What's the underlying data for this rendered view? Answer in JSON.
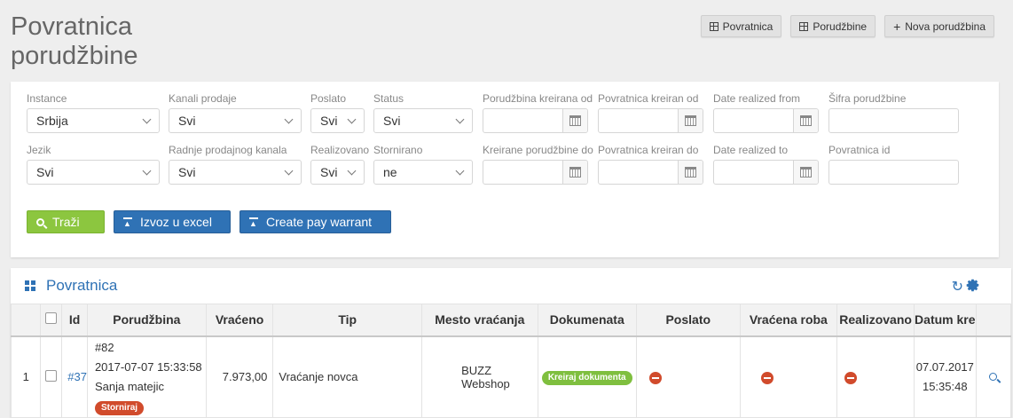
{
  "page": {
    "title_line1": "Povratnica",
    "title_line2": "porudžbine"
  },
  "top_actions": [
    {
      "label": "Povratnica",
      "icon": "grid-icon"
    },
    {
      "label": "Porudžbine",
      "icon": "grid-icon"
    },
    {
      "label": "Nova porudžbina",
      "icon": "plus-icon"
    }
  ],
  "filters": {
    "instance": {
      "label": "Instance",
      "value": "Srbija"
    },
    "kanali": {
      "label": "Kanali prodaje",
      "value": "Svi"
    },
    "poslato": {
      "label": "Poslato",
      "value": "Svi"
    },
    "status": {
      "label": "Status",
      "value": "Svi"
    },
    "porudzbina_od": {
      "label": "Porudžbina kreirana od",
      "value": ""
    },
    "povratnica_od": {
      "label": "Povratnica kreiran od",
      "value": ""
    },
    "realized_from": {
      "label": "Date realized from",
      "value": ""
    },
    "sifra": {
      "label": "Šifra porudžbine",
      "value": ""
    },
    "jezik": {
      "label": "Jezik",
      "value": "Svi"
    },
    "radnje": {
      "label": "Radnje prodajnog kanala",
      "value": "Svi"
    },
    "realizovano": {
      "label": "Realizovano",
      "value": "Svi"
    },
    "stornirano": {
      "label": "Stornirano",
      "value": "ne"
    },
    "porudzbine_do": {
      "label": "Kreirane porudžbine do",
      "value": ""
    },
    "povratnica_do": {
      "label": "Povratnica kreiran do",
      "value": ""
    },
    "realized_to": {
      "label": "Date realized to",
      "value": ""
    },
    "povratnica_id": {
      "label": "Povratnica id",
      "value": ""
    }
  },
  "actions": {
    "search": "Traži",
    "export": "Izvoz u excel",
    "pay_warrant": "Create pay warrant"
  },
  "grid": {
    "title": "Povratnica",
    "columns": [
      "Id",
      "Porudžbina",
      "Vraćeno",
      "Tip",
      "Mesto vraćanja",
      "Dokumenata",
      "Poslato",
      "Vraćena roba",
      "Realizovano",
      "Datum kre"
    ],
    "rows": [
      {
        "num": "1",
        "id": "#37",
        "order_no": "#82",
        "order_date": "2017-07-07 15:33:58",
        "customer": "Sanja matejic",
        "order_badge": "Storniraj",
        "returned": "7.973,00",
        "type": "Vraćanje novca",
        "place": "BUZZ Webshop",
        "docs_badge": "Kreiraj dokumenta",
        "date_line1": "07.07.2017",
        "date_line2": "15:35:48"
      }
    ]
  },
  "colors": {
    "accent": "#2f72b5",
    "success": "#8cc63f",
    "danger": "#d14b2c"
  }
}
